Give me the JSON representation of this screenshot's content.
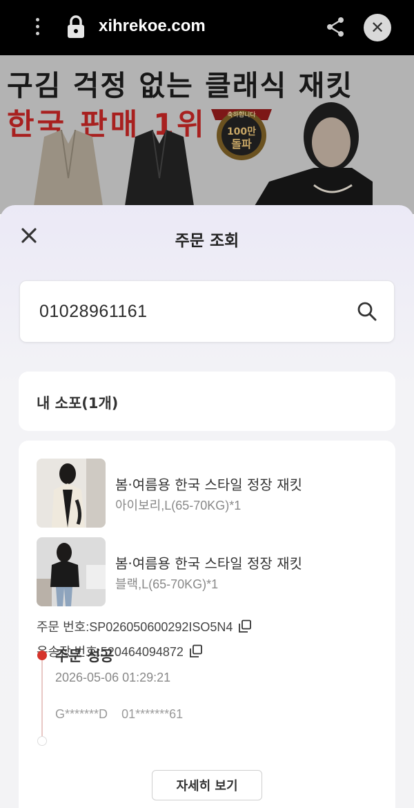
{
  "browser": {
    "url": "xihrekoe.com",
    "close_symbol": "✕"
  },
  "banner": {
    "title": "구김 걱정 없는 클래식 재킷",
    "subtitle": "한국 판매 1위",
    "badge_top": "축하합니다",
    "badge_line1": "100만",
    "badge_line2": "돌파"
  },
  "modal": {
    "title": "주문 조회",
    "search": {
      "value": "01028961161"
    },
    "section_label": "내 소포(1개)",
    "order": {
      "items": [
        {
          "name": "봄·여름용 한국 스타일 정장 재킷",
          "option": "아이보리,L(65-70KG)*1"
        },
        {
          "name": "봄·여름용 한국 스타일 정장 재킷",
          "option": "블랙,L(65-70KG)*1"
        }
      ],
      "order_number": "주문 번호:SP026050600292ISO5N4",
      "tracking_number": "운송장 번호:520464094872",
      "status": "주문 성공",
      "status_time": "2026-05-06 01:29:21",
      "masked_name": "G*******D",
      "masked_phone": "01*******61",
      "detail_button": "자세히 보기"
    }
  },
  "colors": {
    "accent_red": "#d5332b",
    "banner_red": "#a8201f"
  },
  "icons": [
    "more-vert-icon",
    "lock-icon",
    "share-icon",
    "close-icon",
    "search-icon",
    "copy-icon"
  ]
}
